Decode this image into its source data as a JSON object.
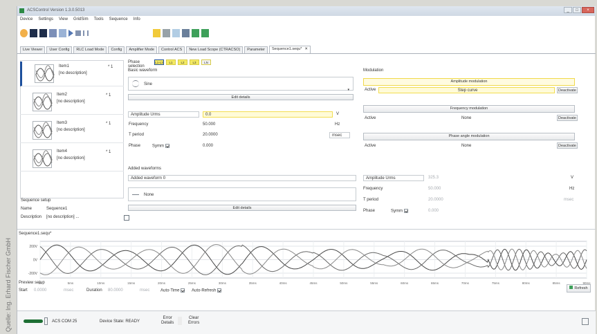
{
  "window": {
    "title": "ACSControl Version 1.3.0.5013"
  },
  "side_credit": "Quelle: Ing. Erhard Fischer GmbH",
  "menu": [
    "Device",
    "Settings",
    "View",
    "GridSim",
    "Tools",
    "Sequence",
    "Info"
  ],
  "tabs": [
    "Live Viewer",
    "User Config",
    "RLC Load Mode",
    "Config",
    "Amplifier Mode",
    "Control ACS",
    "New Load Scope (CTRACSO)",
    "Parameter",
    "Sequence1.sequ*"
  ],
  "tabs_close": "✕",
  "sequence_items": [
    {
      "title": "Item1",
      "desc": "[no description]",
      "num": "* 1"
    },
    {
      "title": "Item2",
      "desc": "[no description]",
      "num": "* 1"
    },
    {
      "title": "Item3",
      "desc": "[no description]",
      "num": "* 1"
    },
    {
      "title": "Item4",
      "desc": "[no description]",
      "num": "* 1"
    }
  ],
  "sequence_setup": {
    "header": "Sequence setup",
    "name_label": "Name",
    "name_value": "Sequence1",
    "desc_label": "Description",
    "desc_value": "[no description] ..."
  },
  "phase": {
    "label": "Phase selection",
    "buttons": [
      "L1-L3",
      "L1",
      "L2",
      "L3",
      "LN"
    ]
  },
  "basic": {
    "header": "Basic waveform",
    "waveform": "Sine",
    "edit_details": "Edit details",
    "amplitude_mode": "Amplitude Urms",
    "amplitude_value": "0.0",
    "amplitude_unit": "V",
    "frequency_label": "Frequency",
    "frequency_value": "50.000",
    "frequency_unit": "Hz",
    "tperiod_label": "T period",
    "tperiod_value": "20.0000",
    "tperiod_unit": "msec",
    "phase_label": "Phase",
    "symm_label": "Symm",
    "phase_value": "0.000"
  },
  "modulation": {
    "header": "Modulation",
    "amp_button": "Amplitude modulation",
    "freq_button": "Frequency modulation",
    "phase_button": "Phase angle modulation",
    "active_label": "Active",
    "amp_active": "Step curve",
    "freq_active": "None",
    "phase_active": "None",
    "deactivate": "Deactivate"
  },
  "added": {
    "header": "Added waveforms",
    "selector": "Added waveform 0",
    "waveform": "None",
    "edit_details": "Edit details",
    "amplitude_mode": "Amplitude Urms",
    "amplitude_value": "325.3",
    "amplitude_unit": "V",
    "frequency_label": "Frequency",
    "frequency_value": "50.000",
    "frequency_unit": "Hz",
    "tperiod_label": "T period",
    "tperiod_value": "20.0000",
    "tperiod_unit": "msec",
    "phase_label": "Phase",
    "symm_label": "Symm",
    "phase_value": "0.000"
  },
  "plot": {
    "title": "Sequence1.sequ*",
    "ylabels": [
      "200V",
      "0V",
      "-200V"
    ],
    "xlabels": [
      "0s",
      "5ms",
      "10ms",
      "15ms",
      "20ms",
      "25ms",
      "30ms",
      "35ms",
      "40ms",
      "45ms",
      "50ms",
      "55ms",
      "60ms",
      "65ms",
      "70ms",
      "75ms",
      "80ms",
      "85ms",
      "90ms"
    ]
  },
  "preview": {
    "header": "Preview setup",
    "start_label": "Start",
    "start_value": "0.0000",
    "start_unit": "msec",
    "duration_label": "Duration",
    "duration_value": "80.0000",
    "duration_unit": "msec",
    "auto_time": "Auto-Time",
    "auto_refresh": "Auto-Refresh",
    "refresh": "Refresh"
  },
  "status": {
    "connection": "ACS COM 25",
    "device_state": "Device State: READY",
    "error_details_1": "Error",
    "error_details_2": "Details",
    "clear_errors_1": "Clear",
    "clear_errors_2": "Errors"
  },
  "colors": {
    "accent_blue": "#1a4f9f",
    "highlight_yellow": "#f2dd50",
    "plot_bg": "#ffffff",
    "wave_dark": "#444444"
  }
}
